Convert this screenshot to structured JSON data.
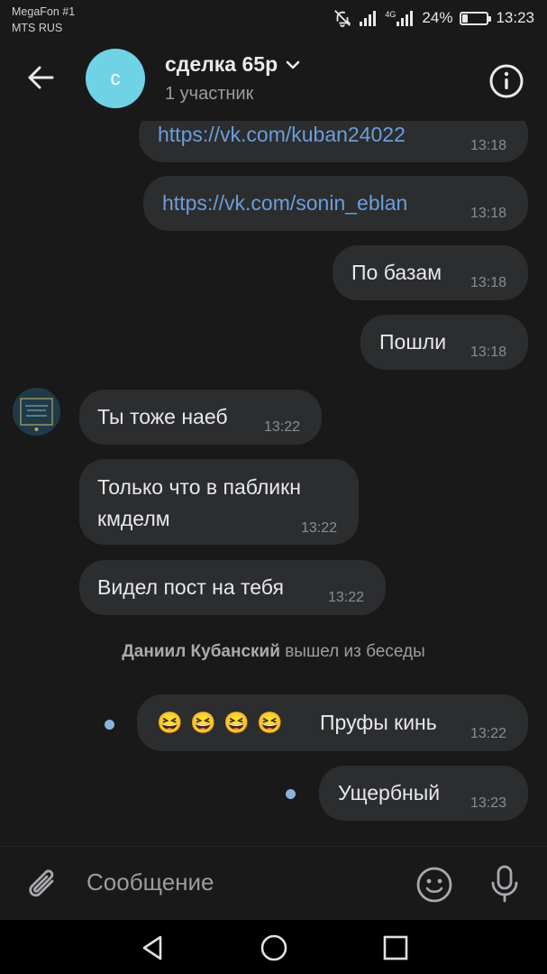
{
  "status": {
    "carrier1": "MegaFon #1",
    "carrier2": "MTS RUS",
    "net": "4G",
    "battery": "24%",
    "battery_level": 0.24,
    "time": "13:23"
  },
  "header": {
    "avatar_letter": "с",
    "title": "сделка 65р",
    "subtitle": "1 участник"
  },
  "messages": [
    {
      "text": "https://vk.com/kuban24022",
      "time": "13:18"
    },
    {
      "text": "https://vk.com/sonin_eblan",
      "time": "13:18"
    },
    {
      "text": "По базам",
      "time": "13:18"
    },
    {
      "text": "Пошли",
      "time": "13:18"
    },
    {
      "text": "Ты тоже наеб",
      "time": "13:22"
    },
    {
      "line1": "Только что в пабликн",
      "line2": "кмделм",
      "time": "13:22"
    },
    {
      "text": "Видел пост на тебя",
      "time": "13:22"
    },
    {
      "emoji": "😆 😆 😆 😆",
      "text": "Пруфы кинь",
      "time": "13:22"
    },
    {
      "text": "Ущербный",
      "time": "13:23"
    }
  ],
  "system_message": {
    "name": "Даниил Кубанский",
    "text": "вышел из беседы"
  },
  "composer": {
    "placeholder": "Сообщение"
  },
  "colors": {
    "background": "#19191a",
    "bubble": "#2c2d2e",
    "link": "#6b9edc",
    "avatar": "#6fd3e5",
    "unread_dot": "#8fb1dd"
  }
}
